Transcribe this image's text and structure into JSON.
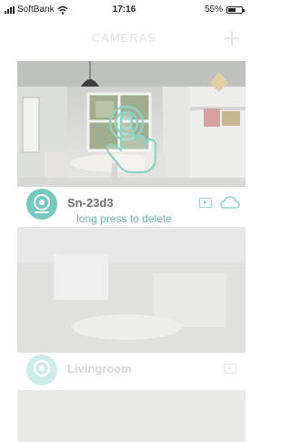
{
  "status_bar": {
    "carrier": "SoftBank",
    "time": "17:16",
    "battery_percent": "55%",
    "battery_level": 0.55
  },
  "header": {
    "title": "CAMERAS",
    "add_icon": "plus-icon"
  },
  "cameras": [
    {
      "name": "Sn-23d3",
      "icon": "camera-lens-icon",
      "actions": [
        "playback-icon",
        "cloud-icon"
      ]
    },
    {
      "name": "Livingroom",
      "icon": "camera-lens-icon",
      "actions": [
        "playback-icon"
      ]
    }
  ],
  "hint_text": "long press to delete",
  "colors": {
    "accent": "#76c9bf",
    "hint": "#6ab3a6",
    "faded_title": "#e3e3e3",
    "name_dark": "#6c6c6c",
    "name_faded": "#d9d9d9"
  }
}
